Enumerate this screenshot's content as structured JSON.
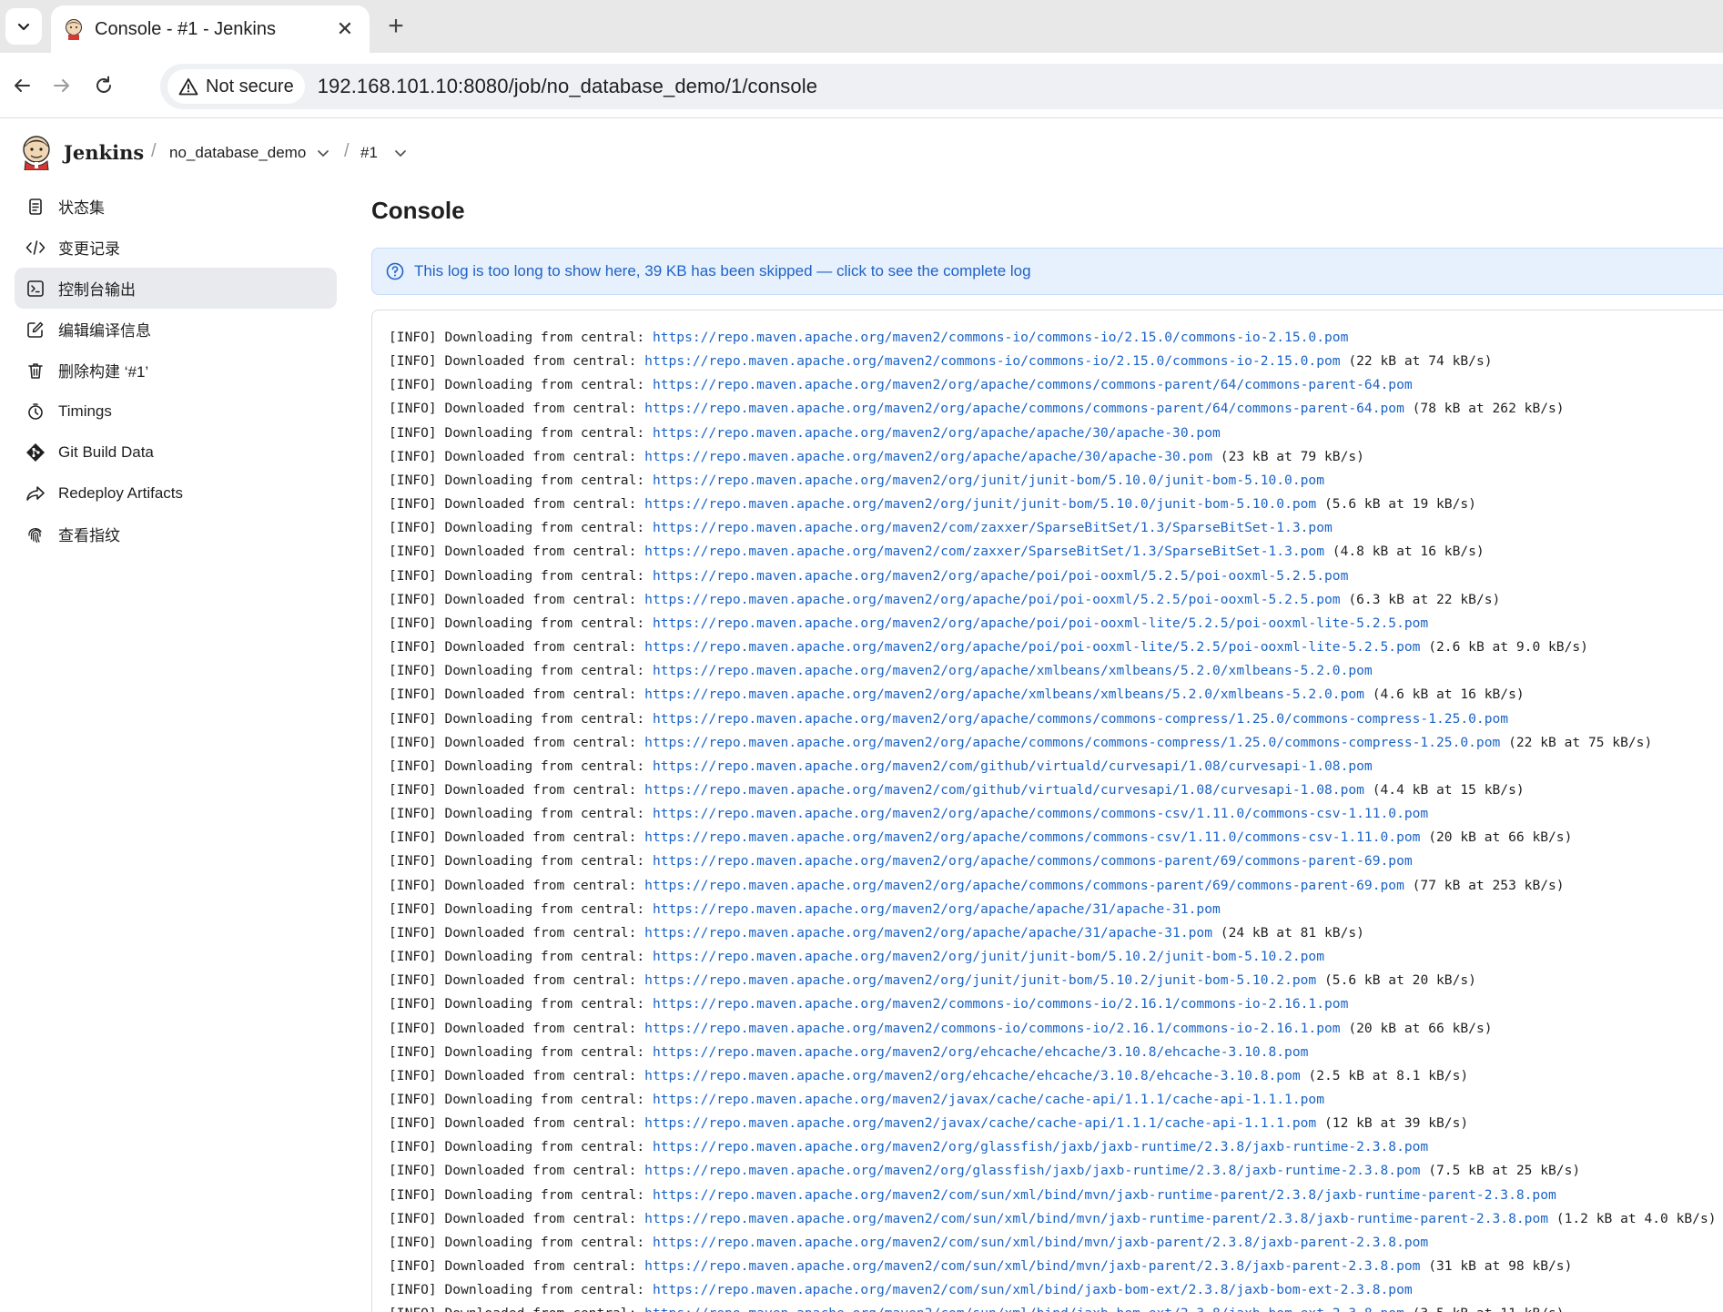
{
  "browser": {
    "tab_title": "Console - #1 - Jenkins",
    "tab_close": "✕",
    "new_tab": "+",
    "security_label": "Not secure",
    "url": "192.168.101.10:8080/job/no_database_demo/1/console"
  },
  "header": {
    "app_name": "Jenkins",
    "breadcrumb_job": "no_database_demo",
    "breadcrumb_build": "#1",
    "separator": "/"
  },
  "sidebar": {
    "items": [
      {
        "label": "状态集",
        "icon": "notepad-icon"
      },
      {
        "label": "变更记录",
        "icon": "code-icon"
      },
      {
        "label": "控制台输出",
        "icon": "terminal-icon"
      },
      {
        "label": "编辑编译信息",
        "icon": "edit-icon"
      },
      {
        "label": "删除构建 ‘#1’",
        "icon": "trash-icon"
      },
      {
        "label": "Timings",
        "icon": "stopwatch-icon"
      },
      {
        "label": "Git Build Data",
        "icon": "git-icon"
      },
      {
        "label": "Redeploy Artifacts",
        "icon": "redeploy-icon"
      },
      {
        "label": "查看指纹",
        "icon": "fingerprint-icon"
      }
    ]
  },
  "main": {
    "title": "Console",
    "notice": "This log is too long to show here, 39 KB has been skipped — click to see the complete log"
  },
  "log": [
    {
      "prefix": "[INFO] Downloading from central: ",
      "url": "https://repo.maven.apache.org/maven2/commons-io/commons-io/2.15.0/commons-io-2.15.0.pom",
      "suffix": ""
    },
    {
      "prefix": "[INFO] Downloaded from central: ",
      "url": "https://repo.maven.apache.org/maven2/commons-io/commons-io/2.15.0/commons-io-2.15.0.pom",
      "suffix": " (22 kB at 74 kB/s)"
    },
    {
      "prefix": "[INFO] Downloading from central: ",
      "url": "https://repo.maven.apache.org/maven2/org/apache/commons/commons-parent/64/commons-parent-64.pom",
      "suffix": ""
    },
    {
      "prefix": "[INFO] Downloaded from central: ",
      "url": "https://repo.maven.apache.org/maven2/org/apache/commons/commons-parent/64/commons-parent-64.pom",
      "suffix": " (78 kB at 262 kB/s)"
    },
    {
      "prefix": "[INFO] Downloading from central: ",
      "url": "https://repo.maven.apache.org/maven2/org/apache/apache/30/apache-30.pom",
      "suffix": ""
    },
    {
      "prefix": "[INFO] Downloaded from central: ",
      "url": "https://repo.maven.apache.org/maven2/org/apache/apache/30/apache-30.pom",
      "suffix": " (23 kB at 79 kB/s)"
    },
    {
      "prefix": "[INFO] Downloading from central: ",
      "url": "https://repo.maven.apache.org/maven2/org/junit/junit-bom/5.10.0/junit-bom-5.10.0.pom",
      "suffix": ""
    },
    {
      "prefix": "[INFO] Downloaded from central: ",
      "url": "https://repo.maven.apache.org/maven2/org/junit/junit-bom/5.10.0/junit-bom-5.10.0.pom",
      "suffix": " (5.6 kB at 19 kB/s)"
    },
    {
      "prefix": "[INFO] Downloading from central: ",
      "url": "https://repo.maven.apache.org/maven2/com/zaxxer/SparseBitSet/1.3/SparseBitSet-1.3.pom",
      "suffix": ""
    },
    {
      "prefix": "[INFO] Downloaded from central: ",
      "url": "https://repo.maven.apache.org/maven2/com/zaxxer/SparseBitSet/1.3/SparseBitSet-1.3.pom",
      "suffix": " (4.8 kB at 16 kB/s)"
    },
    {
      "prefix": "[INFO] Downloading from central: ",
      "url": "https://repo.maven.apache.org/maven2/org/apache/poi/poi-ooxml/5.2.5/poi-ooxml-5.2.5.pom",
      "suffix": ""
    },
    {
      "prefix": "[INFO] Downloaded from central: ",
      "url": "https://repo.maven.apache.org/maven2/org/apache/poi/poi-ooxml/5.2.5/poi-ooxml-5.2.5.pom",
      "suffix": " (6.3 kB at 22 kB/s)"
    },
    {
      "prefix": "[INFO] Downloading from central: ",
      "url": "https://repo.maven.apache.org/maven2/org/apache/poi/poi-ooxml-lite/5.2.5/poi-ooxml-lite-5.2.5.pom",
      "suffix": ""
    },
    {
      "prefix": "[INFO] Downloaded from central: ",
      "url": "https://repo.maven.apache.org/maven2/org/apache/poi/poi-ooxml-lite/5.2.5/poi-ooxml-lite-5.2.5.pom",
      "suffix": " (2.6 kB at 9.0 kB/s)"
    },
    {
      "prefix": "[INFO] Downloading from central: ",
      "url": "https://repo.maven.apache.org/maven2/org/apache/xmlbeans/xmlbeans/5.2.0/xmlbeans-5.2.0.pom",
      "suffix": ""
    },
    {
      "prefix": "[INFO] Downloaded from central: ",
      "url": "https://repo.maven.apache.org/maven2/org/apache/xmlbeans/xmlbeans/5.2.0/xmlbeans-5.2.0.pom",
      "suffix": " (4.6 kB at 16 kB/s)"
    },
    {
      "prefix": "[INFO] Downloading from central: ",
      "url": "https://repo.maven.apache.org/maven2/org/apache/commons/commons-compress/1.25.0/commons-compress-1.25.0.pom",
      "suffix": ""
    },
    {
      "prefix": "[INFO] Downloaded from central: ",
      "url": "https://repo.maven.apache.org/maven2/org/apache/commons/commons-compress/1.25.0/commons-compress-1.25.0.pom",
      "suffix": " (22 kB at 75 kB/s)"
    },
    {
      "prefix": "[INFO] Downloading from central: ",
      "url": "https://repo.maven.apache.org/maven2/com/github/virtuald/curvesapi/1.08/curvesapi-1.08.pom",
      "suffix": ""
    },
    {
      "prefix": "[INFO] Downloaded from central: ",
      "url": "https://repo.maven.apache.org/maven2/com/github/virtuald/curvesapi/1.08/curvesapi-1.08.pom",
      "suffix": " (4.4 kB at 15 kB/s)"
    },
    {
      "prefix": "[INFO] Downloading from central: ",
      "url": "https://repo.maven.apache.org/maven2/org/apache/commons/commons-csv/1.11.0/commons-csv-1.11.0.pom",
      "suffix": ""
    },
    {
      "prefix": "[INFO] Downloaded from central: ",
      "url": "https://repo.maven.apache.org/maven2/org/apache/commons/commons-csv/1.11.0/commons-csv-1.11.0.pom",
      "suffix": " (20 kB at 66 kB/s)"
    },
    {
      "prefix": "[INFO] Downloading from central: ",
      "url": "https://repo.maven.apache.org/maven2/org/apache/commons/commons-parent/69/commons-parent-69.pom",
      "suffix": ""
    },
    {
      "prefix": "[INFO] Downloaded from central: ",
      "url": "https://repo.maven.apache.org/maven2/org/apache/commons/commons-parent/69/commons-parent-69.pom",
      "suffix": " (77 kB at 253 kB/s)"
    },
    {
      "prefix": "[INFO] Downloading from central: ",
      "url": "https://repo.maven.apache.org/maven2/org/apache/apache/31/apache-31.pom",
      "suffix": ""
    },
    {
      "prefix": "[INFO] Downloaded from central: ",
      "url": "https://repo.maven.apache.org/maven2/org/apache/apache/31/apache-31.pom",
      "suffix": " (24 kB at 81 kB/s)"
    },
    {
      "prefix": "[INFO] Downloading from central: ",
      "url": "https://repo.maven.apache.org/maven2/org/junit/junit-bom/5.10.2/junit-bom-5.10.2.pom",
      "suffix": ""
    },
    {
      "prefix": "[INFO] Downloaded from central: ",
      "url": "https://repo.maven.apache.org/maven2/org/junit/junit-bom/5.10.2/junit-bom-5.10.2.pom",
      "suffix": " (5.6 kB at 20 kB/s)"
    },
    {
      "prefix": "[INFO] Downloading from central: ",
      "url": "https://repo.maven.apache.org/maven2/commons-io/commons-io/2.16.1/commons-io-2.16.1.pom",
      "suffix": ""
    },
    {
      "prefix": "[INFO] Downloaded from central: ",
      "url": "https://repo.maven.apache.org/maven2/commons-io/commons-io/2.16.1/commons-io-2.16.1.pom",
      "suffix": " (20 kB at 66 kB/s)"
    },
    {
      "prefix": "[INFO] Downloading from central: ",
      "url": "https://repo.maven.apache.org/maven2/org/ehcache/ehcache/3.10.8/ehcache-3.10.8.pom",
      "suffix": ""
    },
    {
      "prefix": "[INFO] Downloaded from central: ",
      "url": "https://repo.maven.apache.org/maven2/org/ehcache/ehcache/3.10.8/ehcache-3.10.8.pom",
      "suffix": " (2.5 kB at 8.1 kB/s)"
    },
    {
      "prefix": "[INFO] Downloading from central: ",
      "url": "https://repo.maven.apache.org/maven2/javax/cache/cache-api/1.1.1/cache-api-1.1.1.pom",
      "suffix": ""
    },
    {
      "prefix": "[INFO] Downloaded from central: ",
      "url": "https://repo.maven.apache.org/maven2/javax/cache/cache-api/1.1.1/cache-api-1.1.1.pom",
      "suffix": " (12 kB at 39 kB/s)"
    },
    {
      "prefix": "[INFO] Downloading from central: ",
      "url": "https://repo.maven.apache.org/maven2/org/glassfish/jaxb/jaxb-runtime/2.3.8/jaxb-runtime-2.3.8.pom",
      "suffix": ""
    },
    {
      "prefix": "[INFO] Downloaded from central: ",
      "url": "https://repo.maven.apache.org/maven2/org/glassfish/jaxb/jaxb-runtime/2.3.8/jaxb-runtime-2.3.8.pom",
      "suffix": " (7.5 kB at 25 kB/s)"
    },
    {
      "prefix": "[INFO] Downloading from central: ",
      "url": "https://repo.maven.apache.org/maven2/com/sun/xml/bind/mvn/jaxb-runtime-parent/2.3.8/jaxb-runtime-parent-2.3.8.pom",
      "suffix": ""
    },
    {
      "prefix": "[INFO] Downloaded from central: ",
      "url": "https://repo.maven.apache.org/maven2/com/sun/xml/bind/mvn/jaxb-runtime-parent/2.3.8/jaxb-runtime-parent-2.3.8.pom",
      "suffix": " (1.2 kB at 4.0 kB/s)"
    },
    {
      "prefix": "[INFO] Downloading from central: ",
      "url": "https://repo.maven.apache.org/maven2/com/sun/xml/bind/mvn/jaxb-parent/2.3.8/jaxb-parent-2.3.8.pom",
      "suffix": ""
    },
    {
      "prefix": "[INFO] Downloaded from central: ",
      "url": "https://repo.maven.apache.org/maven2/com/sun/xml/bind/mvn/jaxb-parent/2.3.8/jaxb-parent-2.3.8.pom",
      "suffix": " (31 kB at 98 kB/s)"
    },
    {
      "prefix": "[INFO] Downloading from central: ",
      "url": "https://repo.maven.apache.org/maven2/com/sun/xml/bind/jaxb-bom-ext/2.3.8/jaxb-bom-ext-2.3.8.pom",
      "suffix": ""
    },
    {
      "prefix": "[INFO] Downloaded from central: ",
      "url": "https://repo.maven.apache.org/maven2/com/sun/xml/bind/jaxb-bom-ext/2.3.8/jaxb-bom-ext-2.3.8.pom",
      "suffix": " (3.5 kB at 11 kB/s)"
    }
  ]
}
